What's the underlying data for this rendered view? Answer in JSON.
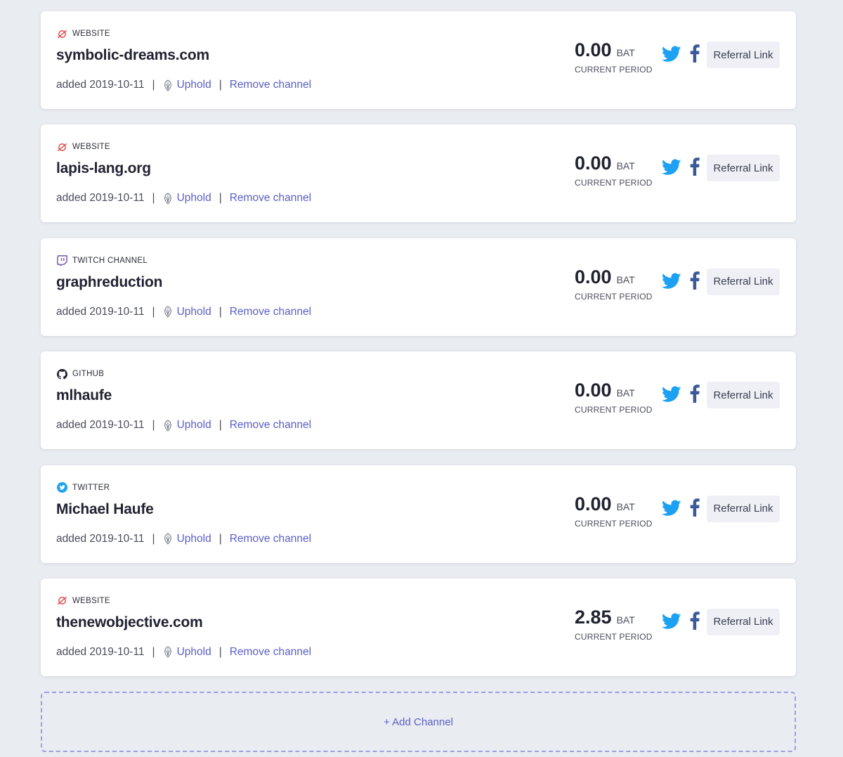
{
  "colors": {
    "background": "#e9ecf0",
    "link": "#5a5fc8",
    "twitter": "#1da1f2",
    "facebook": "#3b5998",
    "website_icon": "#e23b3b",
    "twitch_icon": "#6441a5",
    "github_icon": "#1f2230",
    "dashed_border": "#9a9ee3"
  },
  "channels": [
    {
      "type": "WEBSITE",
      "type_icon": "website-icon",
      "name": "symbolic-dreams.com",
      "added": "added 2019-10-11",
      "wallet": "Uphold",
      "remove": "Remove channel",
      "balance": "0.00",
      "unit": "BAT",
      "period": "CURRENT PERIOD",
      "referral": "Referral Link"
    },
    {
      "type": "WEBSITE",
      "type_icon": "website-icon",
      "name": "lapis-lang.org",
      "added": "added 2019-10-11",
      "wallet": "Uphold",
      "remove": "Remove channel",
      "balance": "0.00",
      "unit": "BAT",
      "period": "CURRENT PERIOD",
      "referral": "Referral Link"
    },
    {
      "type": "TWITCH CHANNEL",
      "type_icon": "twitch-icon",
      "name": "graphreduction",
      "added": "added 2019-10-11",
      "wallet": "Uphold",
      "remove": "Remove channel",
      "balance": "0.00",
      "unit": "BAT",
      "period": "CURRENT PERIOD",
      "referral": "Referral Link"
    },
    {
      "type": "GITHUB",
      "type_icon": "github-icon",
      "name": "mlhaufe",
      "added": "added 2019-10-11",
      "wallet": "Uphold",
      "remove": "Remove channel",
      "balance": "0.00",
      "unit": "BAT",
      "period": "CURRENT PERIOD",
      "referral": "Referral Link"
    },
    {
      "type": "TWITTER",
      "type_icon": "twitter-icon",
      "name": "Michael Haufe",
      "added": "added 2019-10-11",
      "wallet": "Uphold",
      "remove": "Remove channel",
      "balance": "0.00",
      "unit": "BAT",
      "period": "CURRENT PERIOD",
      "referral": "Referral Link"
    },
    {
      "type": "WEBSITE",
      "type_icon": "website-icon",
      "name": "thenewobjective.com",
      "added": "added 2019-10-11",
      "wallet": "Uphold",
      "remove": "Remove channel",
      "balance": "2.85",
      "unit": "BAT",
      "period": "CURRENT PERIOD",
      "referral": "Referral Link"
    }
  ],
  "add_channel_label": "+ Add Channel"
}
